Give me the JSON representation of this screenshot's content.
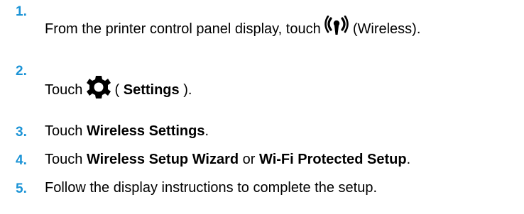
{
  "steps": [
    {
      "number": "1.",
      "before": "From the printer control panel display, touch",
      "icon": "wireless-icon",
      "after": "(Wireless)."
    },
    {
      "number": "2.",
      "before": "Touch",
      "icon": "gear-icon",
      "after_open": "(",
      "bold": "Settings",
      "after_close": ")."
    },
    {
      "number": "3.",
      "before": "Touch",
      "bold": "Wireless Settings",
      "after": "."
    },
    {
      "number": "4.",
      "before": "Touch",
      "bold1": "Wireless Setup Wizard",
      "middle": "or",
      "bold2": "Wi-Fi Protected Setup",
      "after": "."
    },
    {
      "number": "5.",
      "text": "Follow the display instructions to complete the setup."
    }
  ],
  "colors": {
    "step_number": "#1a93d6",
    "text": "#000000"
  }
}
